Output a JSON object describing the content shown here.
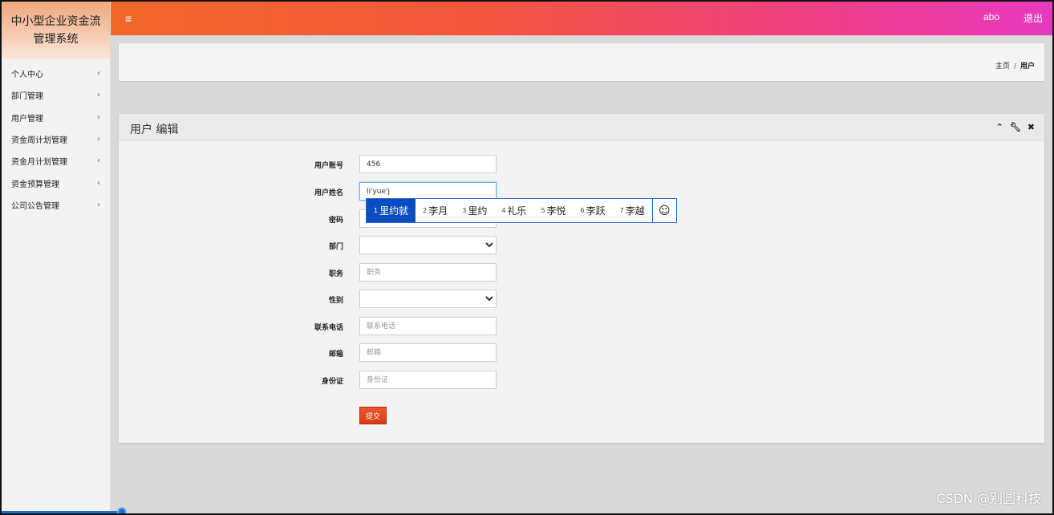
{
  "app": {
    "title": "中小型企业资金流管理系统"
  },
  "sidebar": {
    "items": [
      {
        "label": "个人中心",
        "chevron": "‹"
      },
      {
        "label": "部门管理",
        "chevron": "‹"
      },
      {
        "label": "用户管理",
        "chevron": "‹"
      },
      {
        "label": "资金周计划管理",
        "chevron": "‹"
      },
      {
        "label": "资金月计划管理",
        "chevron": "‹"
      },
      {
        "label": "资金预算管理",
        "chevron": "‹"
      },
      {
        "label": "公司公告管理",
        "chevron": "‹"
      }
    ]
  },
  "topbar": {
    "menu_icon": "≡",
    "user": "abo",
    "logout": "退出"
  },
  "breadcrumb": {
    "home": "主页",
    "separator": "/",
    "current": "用户"
  },
  "panel": {
    "title": "用户 编辑",
    "tools": {
      "collapse": "⌃",
      "wrench": "🔧",
      "close": "✖"
    }
  },
  "form": {
    "account": {
      "label": "用户账号",
      "value": "456"
    },
    "name": {
      "label": "用户姓名",
      "value": "li'yue'j"
    },
    "password": {
      "label": "密码",
      "value": ""
    },
    "department": {
      "label": "部门",
      "value": ""
    },
    "position": {
      "label": "职务",
      "placeholder": "职务"
    },
    "gender": {
      "label": "性别",
      "value": ""
    },
    "phone": {
      "label": "联系电话",
      "placeholder": "联系电话"
    },
    "email": {
      "label": "邮箱",
      "placeholder": "邮箱"
    },
    "id_card": {
      "label": "身份证",
      "placeholder": "身份证"
    },
    "submit": "提交"
  },
  "ime": {
    "candidates": [
      {
        "num": "1",
        "text": "里约就"
      },
      {
        "num": "2",
        "text": "李月"
      },
      {
        "num": "3",
        "text": "里约"
      },
      {
        "num": "4",
        "text": "礼乐"
      },
      {
        "num": "5",
        "text": "李悦"
      },
      {
        "num": "6",
        "text": "李跃"
      },
      {
        "num": "7",
        "text": "李越"
      }
    ],
    "emoji": "☺"
  },
  "watermark": "CSDN @别圆科技",
  "colors": {
    "topbar_start": "#f2682a",
    "topbar_end": "#e83ac0",
    "submit": "#d83b16",
    "ime_selected": "#0b4dc0"
  }
}
